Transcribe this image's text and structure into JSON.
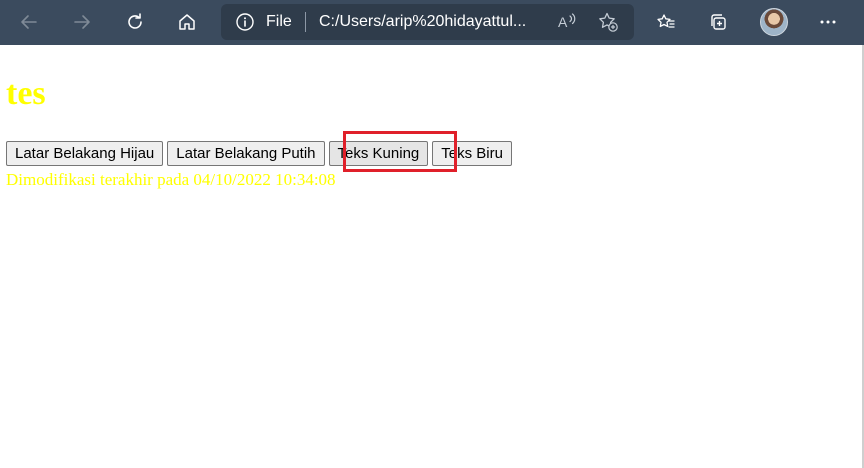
{
  "browser": {
    "address_scheme": "File",
    "address_url": "C:/Users/arip%20hidayattul...",
    "icons": [
      "back-arrow-icon",
      "forward-arrow-icon",
      "refresh-icon",
      "home-icon",
      "info-icon",
      "read-aloud-icon",
      "add-favorite-icon",
      "favorites-icon",
      "collections-icon",
      "profile-avatar",
      "more-icon"
    ]
  },
  "page": {
    "heading": "tes",
    "text_color": "#ffff00",
    "buttons": [
      {
        "label": "Latar Belakang Hijau"
      },
      {
        "label": "Latar Belakang Putih"
      },
      {
        "label": "Teks Kuning"
      },
      {
        "label": "Teks Biru"
      }
    ],
    "modified_text": "Dimodifikasi terakhir pada 04/10/2022 10:34:08"
  },
  "highlight_color": "#e0202a"
}
